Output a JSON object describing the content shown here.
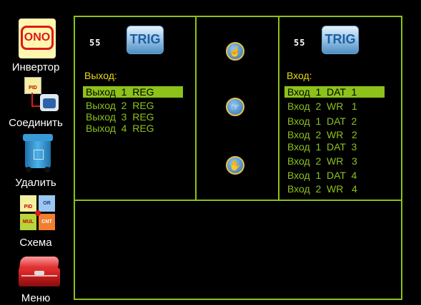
{
  "toolbar": {
    "items": [
      {
        "label": "Инвертор",
        "icon": "inverter-ono-icon"
      },
      {
        "label": "Соединить",
        "icon": "connect-pid-icon"
      },
      {
        "label": "Удалить",
        "icon": "trash-bin-icon"
      },
      {
        "label": "Схема",
        "icon": "scheme-blocks-icon"
      },
      {
        "label": "Меню",
        "icon": "menu-toolbox-icon"
      }
    ],
    "inverter_text": "ONO",
    "scheme_tiles": [
      "PID",
      "OR",
      "MUL",
      "CNT"
    ],
    "connect_tile": "PID"
  },
  "left_panel": {
    "id": "55",
    "badge": "TRIG",
    "header": "Выход:",
    "rows": [
      "Выход  1  REG",
      "Выход  2  REG",
      "Выход  3  REG",
      "Выход  4  REG"
    ],
    "selected_index": 0
  },
  "right_panel": {
    "id": "55",
    "badge": "TRIG",
    "header": "Вход:",
    "rows": [
      "Вход  1  DAT  1",
      "Вход  2  WR   1",
      "Вход  1  DAT  2",
      "Вход  2  WR   2",
      "Вход  1  DAT  3",
      "Вход  2  WR   3",
      "Вход  1  DAT  4",
      "Вход  2  WR   4"
    ],
    "selected_index": 0
  },
  "center_buttons": [
    "hand-point-up-icon",
    "hand-point-right-icon",
    "hand-open-icon"
  ],
  "colors": {
    "frame": "#8cc21a",
    "row_text": "#8cc21a",
    "header_text": "#e9d91d",
    "background": "#000000"
  }
}
